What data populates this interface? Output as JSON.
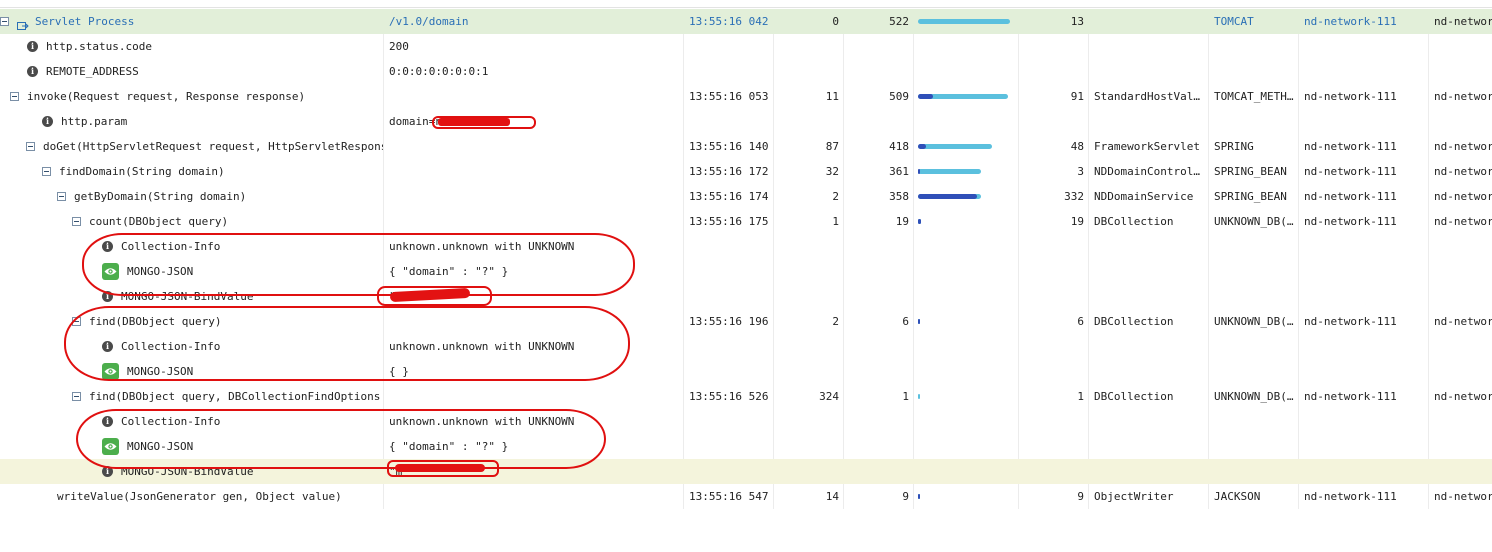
{
  "rows": [
    {
      "label": "Servlet Process",
      "icon": "servlet",
      "arg": "/v1.0/domain",
      "time": "13:55:16 042",
      "n1": "0",
      "n2": "522",
      "bar": {
        "value": 1.0,
        "fill": 0.0
      },
      "n3": "13",
      "cls": "",
      "type": "TOMCAT",
      "host": "nd-network-111",
      "host2": "nd-networ",
      "root": true
    },
    {
      "label": "http.status.code",
      "icon": "info",
      "arg": "200"
    },
    {
      "label": "REMOTE_ADDRESS",
      "icon": "info",
      "arg": "0:0:0:0:0:0:0:1"
    },
    {
      "label": "invoke(Request request, Response response)",
      "icon": "toggle",
      "time": "13:55:16 053",
      "n1": "11",
      "n2": "509",
      "bar": {
        "value": 0.975,
        "fill": 0.17
      },
      "n3": "91",
      "cls": "StandardHostVal…",
      "type": "TOMCAT_METH…",
      "host": "nd-network-111",
      "host2": "nd-networ"
    },
    {
      "label": "http.param",
      "icon": "info",
      "arg": "domain=nd.com"
    },
    {
      "label": "doGet(HttpServletRequest request, HttpServletRespons",
      "icon": "toggle",
      "time": "13:55:16 140",
      "n1": "87",
      "n2": "418",
      "bar": {
        "value": 0.8,
        "fill": 0.11
      },
      "n3": "48",
      "cls": "FrameworkServlet",
      "type": "SPRING",
      "host": "nd-network-111",
      "host2": "nd-networ"
    },
    {
      "label": "findDomain(String domain)",
      "icon": "toggle",
      "time": "13:55:16 172",
      "n1": "32",
      "n2": "361",
      "bar": {
        "value": 0.69,
        "fill": 0.03
      },
      "n3": "3",
      "cls": "NDDomainControl…",
      "type": "SPRING_BEAN",
      "host": "nd-network-111",
      "host2": "nd-networ"
    },
    {
      "label": "getByDomain(String domain)",
      "icon": "toggle",
      "time": "13:55:16 174",
      "n1": "2",
      "n2": "358",
      "bar": {
        "value": 0.69,
        "fill": 0.93
      },
      "n3": "332",
      "cls": "NDDomainService",
      "type": "SPRING_BEAN",
      "host": "nd-network-111",
      "host2": "nd-networ"
    },
    {
      "label": "count(DBObject query)",
      "icon": "toggle",
      "time": "13:55:16 175",
      "n1": "1",
      "n2": "19",
      "bar": {
        "value": 0.036,
        "fill": 1.0
      },
      "n3": "19",
      "cls": "DBCollection",
      "type": "UNKNOWN_DB(…",
      "host": "nd-network-111",
      "host2": "nd-networ"
    },
    {
      "label": "Collection-Info",
      "icon": "info",
      "arg": "unknown.unknown with UNKNOWN"
    },
    {
      "label": "MONGO-JSON",
      "icon": "eye",
      "arg": "{ \"domain\" : \"?\" }"
    },
    {
      "label": "MONGO-JSON-BindValue",
      "icon": "info",
      "arg": "\"\"com"
    },
    {
      "label": "find(DBObject query)",
      "icon": "toggle",
      "time": "13:55:16 196",
      "n1": "2",
      "n2": "6",
      "bar": {
        "value": 0.012,
        "fill": 1.0
      },
      "n3": "6",
      "cls": "DBCollection",
      "type": "UNKNOWN_DB(…",
      "host": "nd-network-111",
      "host2": "nd-networ"
    },
    {
      "label": "Collection-Info",
      "icon": "info",
      "arg": "unknown.unknown with UNKNOWN"
    },
    {
      "label": "MONGO-JSON",
      "icon": "eye",
      "arg": "{ }"
    },
    {
      "label": "find(DBObject query, DBCollectionFindOptions",
      "icon": "toggle",
      "time": "13:55:16 526",
      "n1": "324",
      "n2": "1",
      "bar": {
        "value": 0.004,
        "fill": 0.0
      },
      "n3": "1",
      "cls": "DBCollection",
      "type": "UNKNOWN_DB(…",
      "host": "nd-network-111",
      "host2": "nd-networ"
    },
    {
      "label": "Collection-Info",
      "icon": "info",
      "arg": "unknown.unknown with UNKNOWN"
    },
    {
      "label": "MONGO-JSON",
      "icon": "eye",
      "arg": "{ \"domain\" : \"?\" }"
    },
    {
      "label": "MONGO-JSON-BindValue",
      "icon": "info",
      "arg": "\"m\"",
      "highlight": true
    },
    {
      "label": "writeValue(JsonGenerator gen, Object value)",
      "icon": "none",
      "time": "13:55:16 547",
      "n1": "14",
      "n2": "9",
      "bar": {
        "value": 0.017,
        "fill": 1.0
      },
      "n3": "9",
      "cls": "ObjectWriter",
      "type": "JACKSON",
      "host": "nd-network-111",
      "host2": "nd-networ"
    }
  ]
}
